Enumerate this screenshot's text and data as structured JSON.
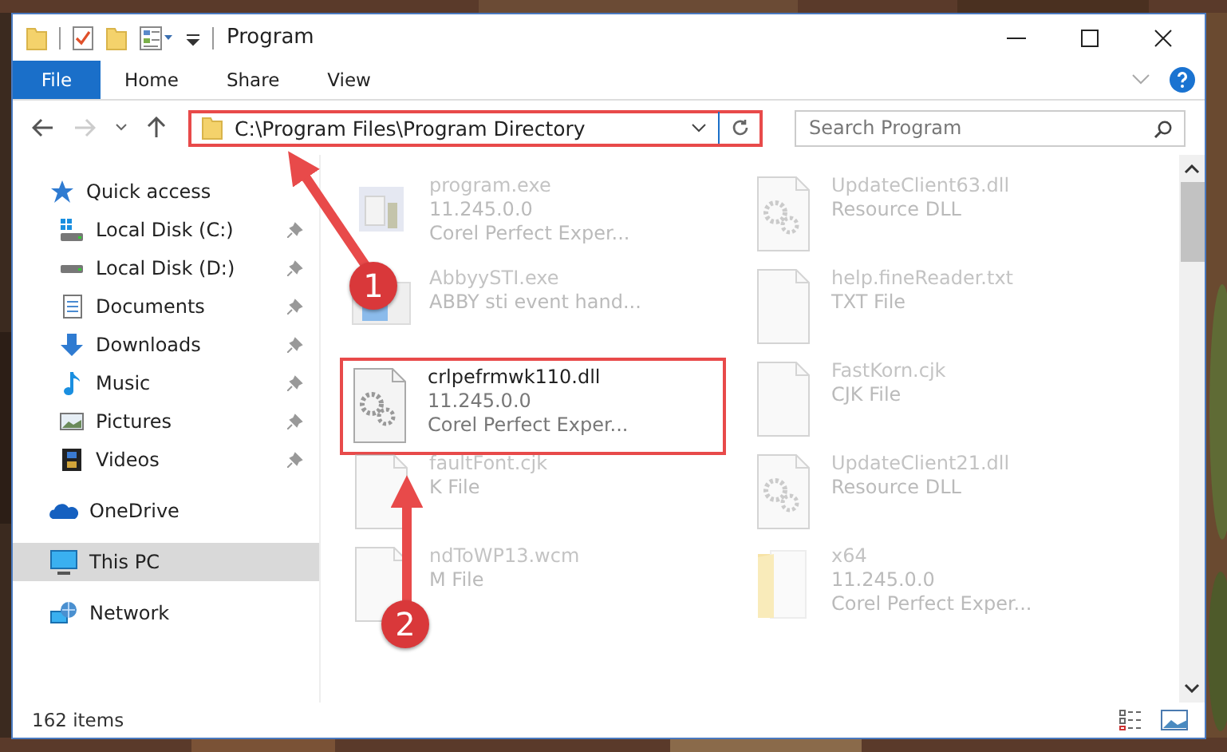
{
  "window": {
    "title": "Program"
  },
  "ribbon": {
    "tabs": [
      {
        "label": "File",
        "selected": true
      },
      {
        "label": "Home",
        "selected": false
      },
      {
        "label": "Share",
        "selected": false
      },
      {
        "label": "View",
        "selected": false
      }
    ]
  },
  "address": {
    "path": "C:\\Program Files\\Program Directory",
    "highlighted": true
  },
  "search": {
    "placeholder": "Search Program"
  },
  "sidebar": {
    "items": [
      {
        "label": "Quick access",
        "kind": "star",
        "selected": false,
        "children": [
          {
            "label": "Local Disk (C:)",
            "kind": "disk-c",
            "pinned": true
          },
          {
            "label": "Local Disk (D:)",
            "kind": "disk",
            "pinned": true
          },
          {
            "label": "Documents",
            "kind": "doc",
            "pinned": true
          },
          {
            "label": "Downloads",
            "kind": "download",
            "pinned": true
          },
          {
            "label": "Music",
            "kind": "music",
            "pinned": true
          },
          {
            "label": "Pictures",
            "kind": "pictures",
            "pinned": true
          },
          {
            "label": "Videos",
            "kind": "videos",
            "pinned": true
          }
        ]
      },
      {
        "label": "OneDrive",
        "kind": "cloud",
        "selected": false
      },
      {
        "label": "This PC",
        "kind": "pc",
        "selected": true
      },
      {
        "label": "Network",
        "kind": "network",
        "selected": false
      }
    ]
  },
  "files": [
    {
      "name": "program.exe",
      "details": [
        "11.245.0.0",
        "Corel Perfect Exper..."
      ],
      "kind": "app",
      "highlighted": false
    },
    {
      "name": "UpdateClient63.dll",
      "details": [
        "Resource DLL"
      ],
      "kind": "gear",
      "highlighted": false
    },
    {
      "name": "AbbyySTI.exe",
      "details": [
        "ABBY sti event hand..."
      ],
      "kind": "window",
      "highlighted": false
    },
    {
      "name": "help.fineReader.txt",
      "details": [
        "TXT File"
      ],
      "kind": "blank",
      "highlighted": false
    },
    {
      "name": "crlpefrmwk110.dll",
      "details": [
        "11.245.0.0",
        "Corel Perfect Exper..."
      ],
      "kind": "gear",
      "highlighted": true
    },
    {
      "name": "FastKorn.cjk",
      "details": [
        "CJK File"
      ],
      "kind": "blank",
      "highlighted": false
    },
    {
      "name": "faultFont.cjk",
      "details": [
        "K File"
      ],
      "kind": "blank",
      "highlighted": false
    },
    {
      "name": "UpdateClient21.dll",
      "details": [
        "Resource DLL"
      ],
      "kind": "gear",
      "highlighted": false
    },
    {
      "name": "ndToWP13.wcm",
      "details": [
        "M File"
      ],
      "kind": "blank",
      "highlighted": false
    },
    {
      "name": "x64",
      "details": [
        "11.245.0.0",
        "Corel Perfect Exper..."
      ],
      "kind": "folder",
      "highlighted": false
    }
  ],
  "annotations": [
    {
      "number": "1"
    },
    {
      "number": "2"
    }
  ],
  "status_bar": {
    "count": "162 items"
  }
}
